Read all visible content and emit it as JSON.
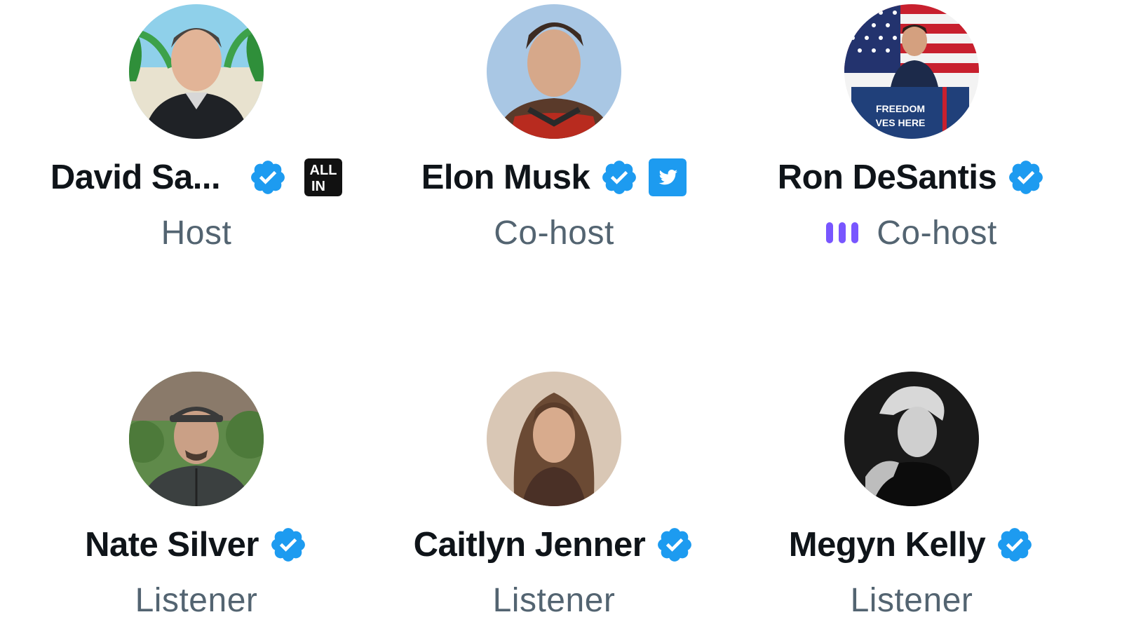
{
  "participants": [
    {
      "name": "David Sa...",
      "role": "Host",
      "verified": true,
      "affiliation": "ALL IN",
      "affiliation_icon": "all-in-badge-icon",
      "speaking": false
    },
    {
      "name": "Elon Musk",
      "role": "Co-host",
      "verified": true,
      "affiliation": "twitter",
      "affiliation_icon": "twitter-bird-icon",
      "speaking": false
    },
    {
      "name": "Ron DeSantis",
      "role": "Co-host",
      "verified": true,
      "affiliation": null,
      "speaking": true
    },
    {
      "name": "Nate Silver",
      "role": "Listener",
      "verified": true,
      "affiliation": null,
      "speaking": false
    },
    {
      "name": "Caitlyn Jenner",
      "role": "Listener",
      "verified": true,
      "affiliation": null,
      "speaking": false
    },
    {
      "name": "Megyn Kelly",
      "role": "Listener",
      "verified": true,
      "affiliation": null,
      "speaking": false
    }
  ],
  "badges": {
    "all_in_line1": "ALL",
    "all_in_line2": "IN",
    "podium_line1": "FREEDOM",
    "podium_line2": "VES HERE"
  },
  "colors": {
    "verified_blue": "#1d9bf0",
    "speaking_purple": "#7856ff",
    "name_text": "#0f1419",
    "role_text": "#536471"
  }
}
